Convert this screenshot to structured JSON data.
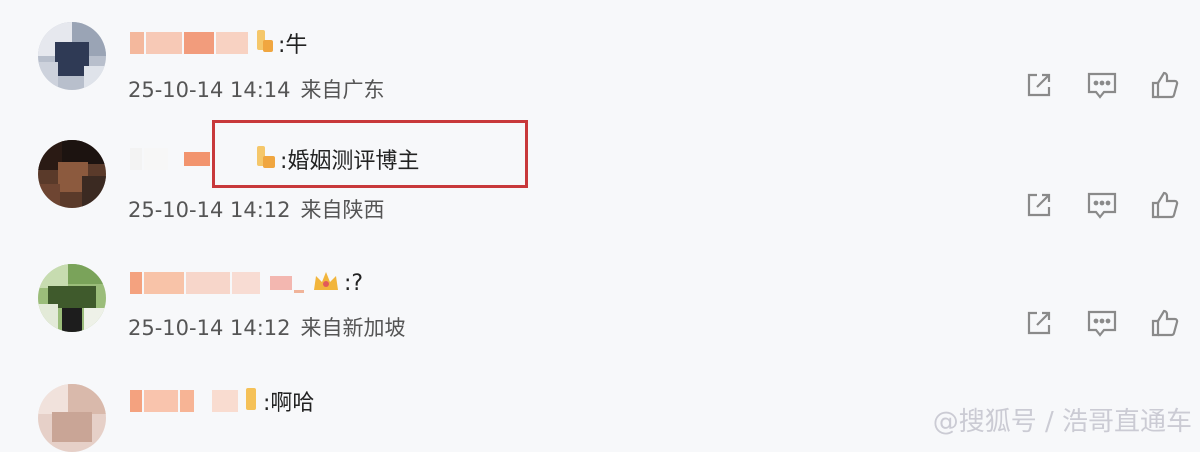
{
  "comments": [
    {
      "text": ":牛",
      "date": "25-10-14 14:14",
      "location": "来自广东"
    },
    {
      "text": ":婚姻测评博主",
      "date": "25-10-14 14:12",
      "location": "来自陕西"
    },
    {
      "text": ":?",
      "date": "25-10-14 14:12",
      "location": "来自新加坡"
    },
    {
      "text": ":啊哈",
      "date": "",
      "location": ""
    }
  ],
  "colors": {
    "highlight": "#c8383b",
    "name_blur": "#f2a98a",
    "icon_gray": "#8a8a8a",
    "badge": "#f5b43a"
  },
  "icons": {
    "share": "share-icon",
    "comment": "comment-icon",
    "like": "like-icon"
  },
  "watermark": "@搜狐号 / 浩哥直通车"
}
